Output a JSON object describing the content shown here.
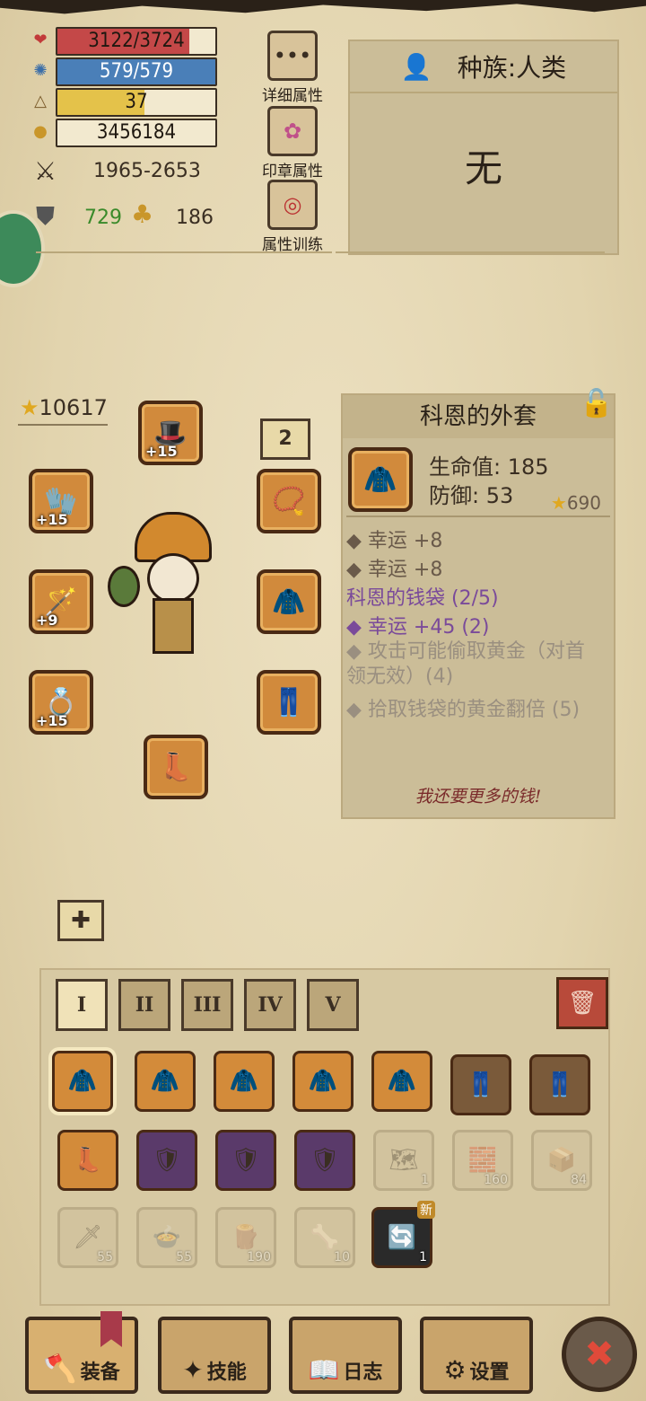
{
  "stats": {
    "hp": {
      "text": "3122/3724",
      "icon": "heart-icon",
      "fraction": 0.838,
      "color": "#c44848"
    },
    "mp": {
      "text": "579/579",
      "icon": "gear-icon",
      "fraction": 1.0,
      "color": "#4a7fb8"
    },
    "level": {
      "text": "37",
      "icon": "triangle-icon",
      "fraction": 0.55,
      "color": "#e4c24a"
    },
    "gold": {
      "text": "3456184",
      "icon": "gold-icon"
    },
    "attack": "1965-2653",
    "defense": "729",
    "luck": "186"
  },
  "menu": {
    "detail": "详细属性",
    "seal": "印章属性",
    "train": "属性训练"
  },
  "race": {
    "title": "种族:人类",
    "value": "无"
  },
  "equip": {
    "score": "10617",
    "page": "2",
    "hat_plus": "+15",
    "glove_plus": "+15",
    "weapon_plus": "+9",
    "ring_plus": "+15"
  },
  "item": {
    "name": "科恩的外套",
    "hp": "生命值: 185",
    "def": "防御: 53",
    "score": "690",
    "stat1": "幸运 +8",
    "stat2": "幸运 +8",
    "set_name": "科恩的钱袋 (2/5)",
    "set1": "幸运 +45 (2)",
    "set2": "攻击可能偷取黄金（对首领无效）(4)",
    "set3": "拾取钱袋的黄金翻倍 (5)",
    "quote": "我还要更多的钱!"
  },
  "tabs": [
    "I",
    "II",
    "III",
    "IV",
    "V"
  ],
  "inventory": {
    "row2_qty": [
      "1",
      "160",
      "84"
    ],
    "row3_qty": [
      "55",
      "55",
      "190",
      "10",
      "1"
    ],
    "new_badge": "新"
  },
  "nav": {
    "equip": "装备",
    "skill": "技能",
    "log": "日志",
    "settings": "设置"
  },
  "colors": {
    "set_purple": "#7a4a9a",
    "hp_green": "#3a8a2a"
  }
}
